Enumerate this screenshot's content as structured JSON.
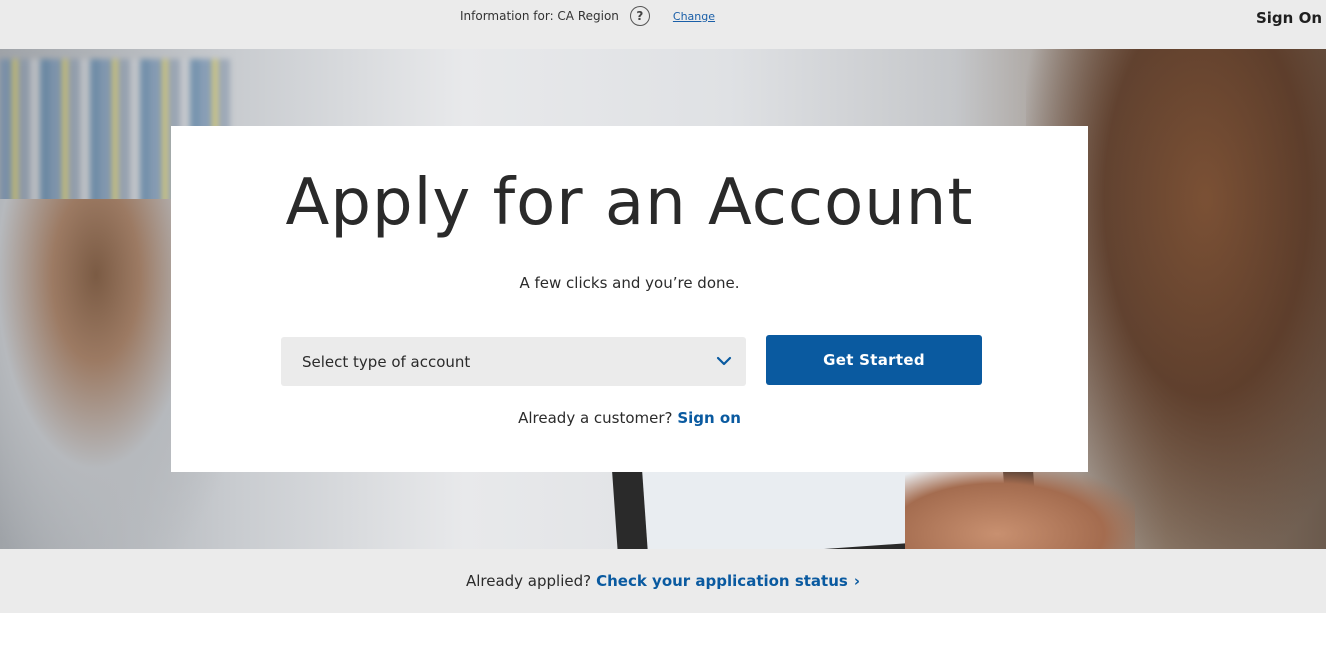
{
  "topbar": {
    "region_text": "Information for: CA Region",
    "help_icon": "question-circle-icon",
    "change_label": "Change",
    "sign_on_label": "Sign On"
  },
  "hero": {
    "background": "blurred-office-photo"
  },
  "card": {
    "title": "Apply for an Account",
    "subtitle": "A few clicks and you’re done.",
    "select": {
      "placeholder": "Select type of account",
      "icon": "chevron-down-icon"
    },
    "get_started_label": "Get Started",
    "already_customer_text": "Already a customer?",
    "sign_on_link": "Sign on"
  },
  "status_bar": {
    "prefix": "Already applied?",
    "link_label": "Check your application status",
    "caret": "›"
  },
  "colors": {
    "brand_blue": "#0a5aa0",
    "bar_gray": "#ebebeb"
  }
}
